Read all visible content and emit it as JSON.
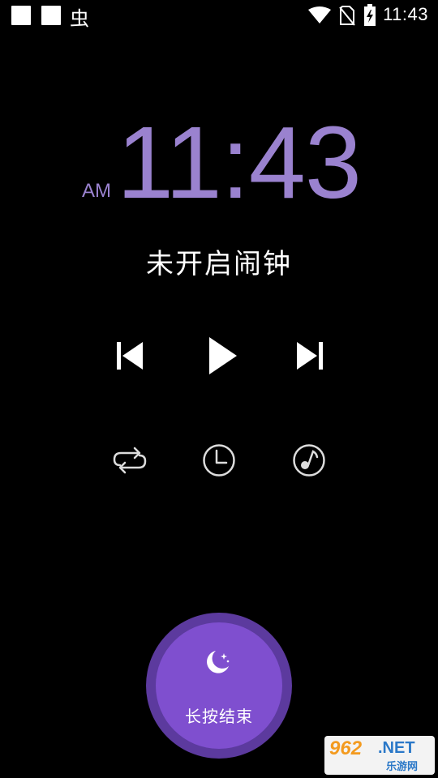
{
  "status_bar": {
    "time": "11:43",
    "app_badge": "虫",
    "icons": [
      "notification-square-icon",
      "notification-square-icon",
      "app-badge-icon",
      "wifi-icon",
      "no-sim-icon",
      "battery-charging-icon"
    ]
  },
  "clock": {
    "ampm": "AM",
    "time": "11:43"
  },
  "alarm_status": "未开启闹钟",
  "controls": {
    "media": [
      "skip-previous-icon",
      "play-icon",
      "skip-next-icon"
    ],
    "modes": [
      "repeat-icon",
      "timer-clock-icon",
      "music-timer-icon"
    ]
  },
  "end_button": {
    "icon": "moon-stars-icon",
    "label": "长按结束"
  },
  "watermark": {
    "number": "962",
    "net": ".NET",
    "site": "乐游网"
  },
  "colors": {
    "accent": "#9a82cf",
    "button_fill": "#7f4fcf",
    "button_ring": "#5c3a9e",
    "background": "#000000"
  }
}
